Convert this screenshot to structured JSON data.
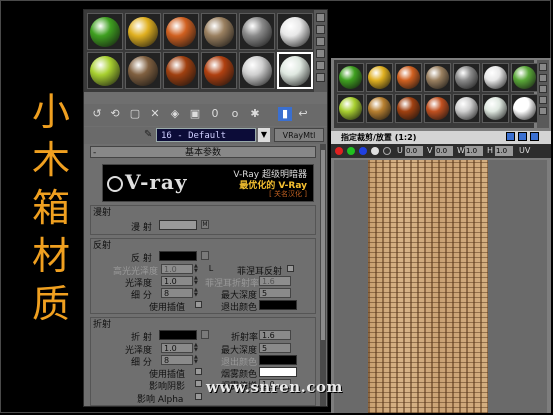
{
  "title_chars": [
    "小",
    "木",
    "箱",
    "材",
    "质"
  ],
  "accent_color": "#f0a020",
  "main_editor": {
    "slot_colors": [
      [
        "#3fa020",
        "#e0b020",
        "#d06020",
        "#9a8060",
        "#8a8a8a",
        "#e8e8e8"
      ],
      [
        "#a8d030",
        "#806040",
        "#a04010",
        "#b04010",
        "#cfcfcf",
        "#dfe8e0"
      ]
    ],
    "toolbar": {
      "dot_icon": "o"
    },
    "material": {
      "name": "16 - Default",
      "type": "VRayMtl",
      "picker_icon": "eyedropper-icon"
    },
    "rollout_title": "基本参数",
    "banner": {
      "logo": "V-ray",
      "line1": "V-Ray 超级明暗器",
      "line2": "最优化的 V-Ray",
      "line3": "[ 关名汉化 ]"
    },
    "diffuse_group": {
      "title": "漫射",
      "label": "漫 射",
      "swatch_color": "#9a9a9a",
      "map_button": "M"
    },
    "reflection_group": {
      "title": "反射",
      "reflect_label": "反 射",
      "reflect_color": "#000000",
      "hilight_gloss_label": "高光光泽度",
      "hilight_gloss_value": "1.0",
      "lock_button": "L",
      "fresnel_label": "菲涅耳反射",
      "gloss_label": "光泽度",
      "gloss_value": "1.0",
      "fresnel_ior_label": "菲涅耳折射率",
      "fresnel_ior_value": "1.6",
      "subdivs_label": "细 分",
      "subdivs_value": "8",
      "max_depth_label": "最大深度",
      "max_depth_value": "5",
      "use_interp_label": "使用插值",
      "exit_color_label": "退出颜色",
      "exit_color": "#000000"
    },
    "refraction_group": {
      "title": "折射",
      "refract_label": "折 射",
      "refract_color": "#000000",
      "ior_label": "折射率",
      "ior_value": "1.6",
      "gloss_label": "光泽度",
      "gloss_value": "1.0",
      "max_depth_label": "最大深度",
      "max_depth_value": "5",
      "subdivs_label": "细 分",
      "subdivs_value": "8",
      "exit_color_label": "退出颜色",
      "exit_color": "#000000",
      "use_interp_label": "使用插值",
      "fog_color_label": "烟雾颜色",
      "fog_color": "#ffffff",
      "affect_shadows_label": "影响阴影",
      "fog_mult_label": "烟雾倍增",
      "fog_mult_value": "1.0",
      "affect_alpha_label": "影响 Alpha"
    }
  },
  "crop_window": {
    "slot_colors": [
      [
        "#3fa020",
        "#e0b020",
        "#d06020",
        "#9a8060",
        "#8a8a8a",
        "#e8e8e8",
        "#5aa838"
      ],
      [
        "#a8d030",
        "#b88030",
        "#a04010",
        "#c05020",
        "#cfcfcf",
        "#dfe8e0",
        "#ffffff"
      ]
    ],
    "title": "指定裁剪/放置 (1:2)",
    "channels": {
      "u_label": "U",
      "u_value": "0.0",
      "v_label": "V",
      "v_value": "0.0",
      "w_label": "W",
      "w_value": "1.0",
      "h_label": "H",
      "h_value": "1.0",
      "uv_label": "UV"
    }
  },
  "watermark": "www.snren.com"
}
